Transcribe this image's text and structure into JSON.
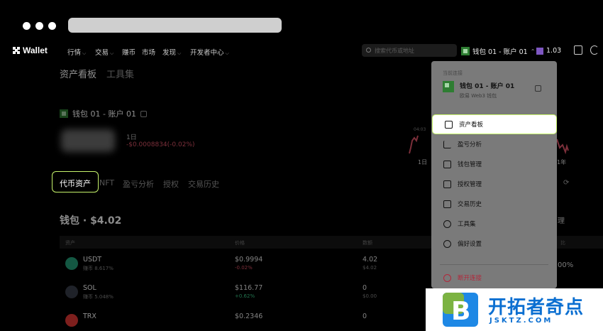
{
  "nav": {
    "logo": "Wallet",
    "items": [
      {
        "label": "行情",
        "has_dropdown": true
      },
      {
        "label": "交易",
        "has_dropdown": true
      },
      {
        "label": "赚币",
        "has_dropdown": false
      },
      {
        "label": "市场",
        "has_dropdown": false
      },
      {
        "label": "发现",
        "has_dropdown": true
      },
      {
        "label": "开发者中心",
        "has_dropdown": true
      }
    ],
    "search_placeholder": "搜索代币或地址",
    "account_label": "钱包 01 - 账户 01",
    "balance": "1.03"
  },
  "main": {
    "top_tabs": [
      "资产看板",
      "工具集"
    ],
    "wallet_name": "钱包 01 - 账户 01",
    "pnl_period": "1日",
    "pnl_value": "-$0.0008834(-0.02%)",
    "chart_labels": {
      "left": "1日",
      "right": "1年",
      "tick": "04:03"
    },
    "sub_tabs": [
      "代币资产",
      "NFT",
      "盈亏分析",
      "授权",
      "交易历史"
    ],
    "wallet_heading": "钱包 · $4.02",
    "table_headers": [
      "资产",
      "价格",
      "数额"
    ],
    "right_cut": {
      "label": "理",
      "col": "比",
      "pct": "00%"
    },
    "rows": [
      {
        "symbol": "USDT",
        "sub": "赚币 8.617%",
        "price": "$0.9994",
        "change": "-0.02%",
        "change_color": "#e0566a",
        "amount": "4.02",
        "amount_usd": "$4.02",
        "icon_color": "#26a17b"
      },
      {
        "symbol": "SOL",
        "sub": "赚币 5.048%",
        "price": "$116.77",
        "change": "+0.62%",
        "change_color": "#3ecf8e",
        "amount": "0",
        "amount_usd": "$0.00",
        "icon_color": "#3a3f4b"
      },
      {
        "symbol": "TRX",
        "sub": "",
        "price": "$0.2346",
        "change": "",
        "change_color": "#3ecf8e",
        "amount": "0",
        "amount_usd": "",
        "icon_color": "#e53935"
      }
    ]
  },
  "panel": {
    "header": "当前连接",
    "account_name": "钱包 01 - 账户 01",
    "account_sub": "欧易 Web3 钱包",
    "menu": [
      {
        "label": "资产看板",
        "icon": "dashboard-icon",
        "active": true
      },
      {
        "label": "盈亏分析",
        "icon": "trend-icon",
        "active": false
      },
      {
        "label": "钱包管理",
        "icon": "wallet-icon",
        "active": false
      },
      {
        "label": "授权管理",
        "icon": "auth-icon",
        "active": false
      },
      {
        "label": "交易历史",
        "icon": "history-icon",
        "active": false
      },
      {
        "label": "工具集",
        "icon": "wrench-icon",
        "active": false
      },
      {
        "label": "偏好设置",
        "icon": "settings-icon",
        "active": false
      }
    ],
    "disconnect": "断开连接"
  },
  "watermark": {
    "title": "开拓者奇点",
    "sub": "JSKTZ.COM"
  },
  "colors": {
    "accent": "#c6f36b",
    "danger": "#b3263a",
    "brand_blue": "#0b6fd1"
  }
}
